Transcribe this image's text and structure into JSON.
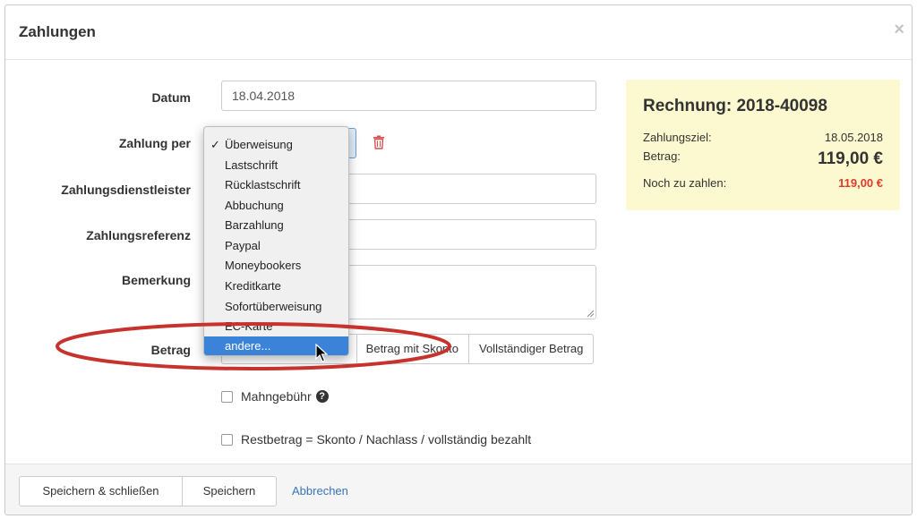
{
  "modal": {
    "title": "Zahlungen",
    "close_label": "×"
  },
  "form": {
    "datum": {
      "label": "Datum",
      "value": "18.04.2018"
    },
    "zahlung_per": {
      "label": "Zahlung per"
    },
    "dienstleister": {
      "label": "Zahlungsdienstleister",
      "value": ""
    },
    "referenz": {
      "label": "Zahlungsreferenz",
      "value": ""
    },
    "bemerkung": {
      "label": "Bemerkung",
      "value": ""
    },
    "betrag": {
      "label": "Betrag",
      "buttons": [
        "Betrag mit Skonto",
        "Vollständiger Betrag"
      ]
    },
    "mahngebuehr": {
      "label": "Mahngebühr",
      "checked": false,
      "help_icon": "question-circle-icon"
    },
    "restbetrag": {
      "label": "Restbetrag = Skonto / Nachlass / vollständig bezahlt",
      "checked": false
    }
  },
  "dropdown": {
    "checkmark": "✓",
    "items": [
      "Überweisung",
      "Lastschrift",
      "Rücklastschrift",
      "Abbuchung",
      "Barzahlung",
      "Paypal",
      "Moneybookers",
      "Kreditkarte",
      "Sofortüberweisung",
      "EC-Karte",
      "andere..."
    ],
    "checked_item": "Überweisung",
    "highlighted_item": "andere..."
  },
  "invoice": {
    "title": "Rechnung: 2018-40098",
    "zahlungsziel_label": "Zahlungsziel:",
    "zahlungsziel_value": "18.05.2018",
    "betrag_label": "Betrag:",
    "betrag_value": "119,00 €",
    "noch_label": "Noch zu zahlen:",
    "noch_value": "119,00 €"
  },
  "footer": {
    "save_close": "Speichern & schließen",
    "save": "Speichern",
    "cancel": "Abbrechen"
  },
  "colors": {
    "invoice_bg": "#fcf8cf",
    "due_red": "#e03a2c",
    "link_blue": "#3a72b7",
    "highlight_blue": "#3b83d8",
    "annotation_red": "#c8322c",
    "trash_red": "#d9534f"
  }
}
